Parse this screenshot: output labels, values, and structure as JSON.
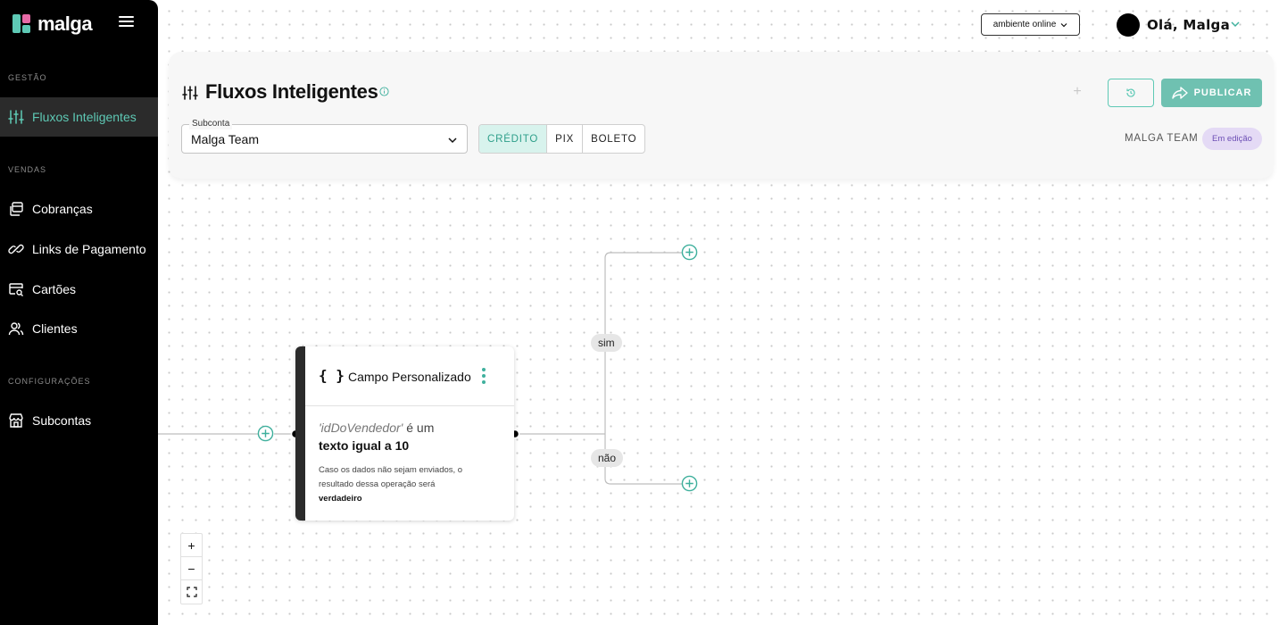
{
  "brand": {
    "name": "malga"
  },
  "sidebar": {
    "sections": [
      {
        "label": "GESTÃO"
      },
      {
        "label": "VENDAS"
      },
      {
        "label": "CONFIGURAÇÕES"
      }
    ],
    "items": [
      {
        "label": "Fluxos Inteligentes",
        "icon": "sliders-icon",
        "active": true
      },
      {
        "label": "Cobranças",
        "icon": "copy-icon"
      },
      {
        "label": "Links de Pagamento",
        "icon": "link-icon"
      },
      {
        "label": "Cartões",
        "icon": "card-search-icon"
      },
      {
        "label": "Clientes",
        "icon": "users-icon"
      },
      {
        "label": "Subcontas",
        "icon": "store-icon"
      }
    ]
  },
  "topbar": {
    "environment": "ambiente online",
    "greeting": "Olá, Malga"
  },
  "header": {
    "title": "Fluxos Inteligentes",
    "subconta_label": "Subconta",
    "subconta_value": "Malga Team",
    "tabs": [
      {
        "label": "CRÉDITO",
        "active": true
      },
      {
        "label": "PIX"
      },
      {
        "label": "BOLETO"
      }
    ],
    "add_label": "+",
    "publish_label": "PUBLICAR",
    "team": "MALGA TEAM",
    "status": "Em edição"
  },
  "node": {
    "icon": "{ }",
    "title": "Campo Personalizado",
    "field": "'idDoVendedor'",
    "connector": "é um",
    "condition": "texto igual a 10",
    "note": "Caso os dados não sejam enviados, o resultado dessa operação será",
    "note_value": "verdadeiro"
  },
  "edges": {
    "yes": "sim",
    "no": "não"
  },
  "zoom": {
    "in": "+",
    "out": "−"
  },
  "colors": {
    "accent": "#5ec9b5",
    "publish": "#6fc1b1",
    "badge_bg": "#e4daf5",
    "badge_text": "#6d4fb5",
    "sidebar_bg": "#000000"
  }
}
